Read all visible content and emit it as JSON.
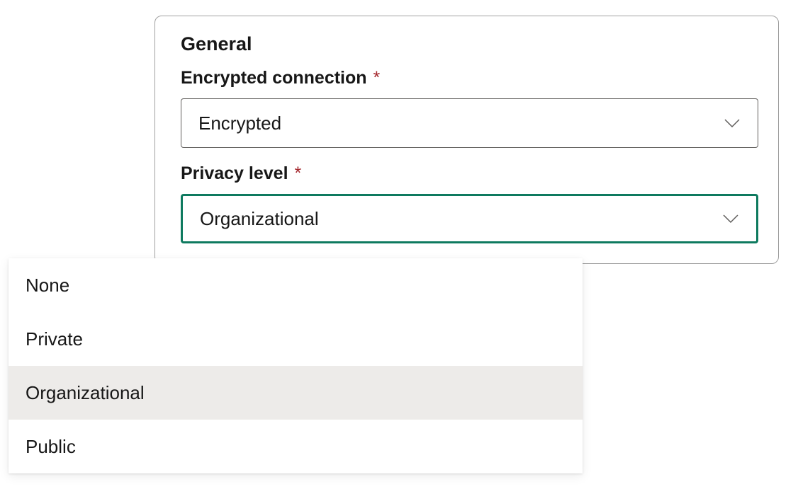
{
  "general": {
    "heading": "General",
    "encrypted_connection": {
      "label": "Encrypted connection",
      "required_mark": "*",
      "value": "Encrypted"
    },
    "privacy_level": {
      "label": "Privacy level",
      "required_mark": "*",
      "value": "Organizational",
      "options": [
        "None",
        "Private",
        "Organizational",
        "Public"
      ],
      "selected_index": 2
    }
  },
  "colors": {
    "active_border": "#0e7a5f",
    "required_mark": "#a4262c"
  }
}
